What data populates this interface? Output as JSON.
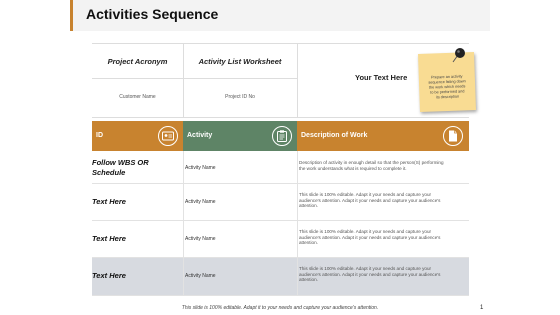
{
  "title": "Activities Sequence",
  "info": {
    "head1": "Project Acronym",
    "head2": "Activity List Worksheet",
    "val1": "Customer Name",
    "val2": "Project ID No",
    "your_text": "Your Text Here"
  },
  "sticky_note": {
    "line1": "Prepare an activity",
    "line2": "sequence listing down",
    "line3": "the work which needs",
    "line4": "to be performed and",
    "line5": "its description"
  },
  "table": {
    "headers": {
      "id": "ID",
      "activity": "Activity",
      "description": "Description of Work"
    },
    "rows": [
      {
        "id_line1": "Follow WBS OR",
        "id_line2": "Schedule",
        "activity": "Activity Name",
        "desc1": "Description of activity in enough detail so that the person(S) performing",
        "desc2": "the work understands what is required to complete it.",
        "desc3": ""
      },
      {
        "id_line1": "Text Here",
        "id_line2": "",
        "activity": "Activity Name",
        "desc1": "This slide is 100% editable. Adapt it your needs and capture your",
        "desc2": "audience's attention. Adapt it your needs and capture your audience's",
        "desc3": "attention."
      },
      {
        "id_line1": "Text Here",
        "id_line2": "",
        "activity": "Activity Name",
        "desc1": "This slide is 100% editable. Adapt it your needs and capture your",
        "desc2": "audience's attention. Adapt it your needs and capture your audience's",
        "desc3": "attention."
      },
      {
        "id_line1": "Text Here",
        "id_line2": "",
        "activity": "Activity Name",
        "desc1": "This slide is 100% editable. Adapt it your needs and capture your",
        "desc2": "audience's attention. Adapt it your needs and capture your audience's",
        "desc3": "attention."
      }
    ]
  },
  "footer": "This slide is 100% editable. Adapt it to your needs and capture your audience's attention.",
  "page_number": "1",
  "colors": {
    "accent_orange": "#c8832f",
    "accent_green": "#5e8466",
    "note_yellow": "#f9dc93",
    "shaded_row": "#d7dae0"
  },
  "icons": [
    "id-card-icon",
    "clipboard-icon",
    "document-icon",
    "pushpin-icon"
  ]
}
